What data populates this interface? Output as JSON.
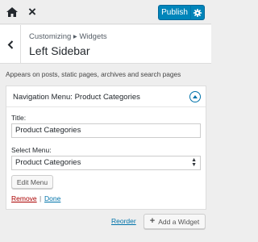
{
  "topbar": {
    "home_icon": "home-icon",
    "close_glyph": "×",
    "publish_label": "Publish",
    "gear_icon": "gear-icon",
    "accent": "#0085ba"
  },
  "header": {
    "breadcrumb": "Customizing ▸ Widgets",
    "title": "Left Sidebar",
    "back_icon": "chevron-left-icon"
  },
  "description": "Appears on posts, static pages, archives and search pages",
  "widget": {
    "title": "Navigation Menu: Product Categories",
    "toggle_icon": "chevron-up-icon",
    "title_label": "Title:",
    "title_value": "Product Categories",
    "menu_label": "Select Menu:",
    "menu_selected": "Product Categories",
    "edit_menu_label": "Edit Menu",
    "remove_label": "Remove",
    "separator": "|",
    "done_label": "Done"
  },
  "footer": {
    "reorder_label": "Reorder",
    "add_widget_label": "Add a Widget",
    "plus_icon": "plus-icon"
  }
}
